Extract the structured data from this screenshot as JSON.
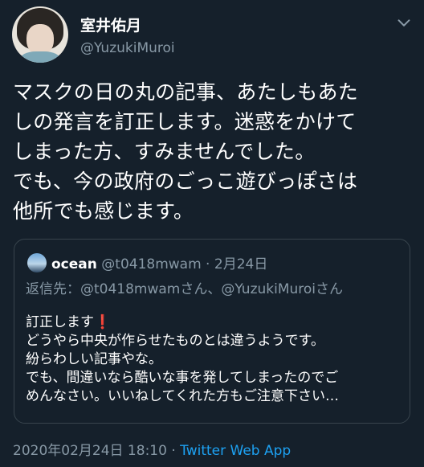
{
  "author": {
    "display_name": "室井佑月",
    "handle": "@YuzukiMuroi"
  },
  "icons": {
    "menu": "chevron-down-icon",
    "avatar": "profile-photo",
    "quoted_avatar": "profile-photo"
  },
  "tweet": {
    "lines": [
      "マスクの日の丸の記事、あたしもあた",
      "しの発言を訂正します。迷惑をかけて",
      "しまった方、すみませんでした。",
      "でも、今の政府のごっこ遊びっぽさは",
      "他所でも感じます。"
    ]
  },
  "quoted": {
    "name": "ocean",
    "handle": "@t0418mwam",
    "separator": " · ",
    "date": "2月24日",
    "reply_to": "返信先：@t0418mwamさん、@YuzukiMuroiさん",
    "first_line": "訂正します",
    "first_line_mark": "❗",
    "lines": [
      "どうやら中央が作らせたものとは違うようです。",
      "紛らわしい記事やな。",
      "でも、間違いなら酷いな事を発してしまったのでご",
      "めんなさい。いいねしてくれた方もご注意下さい…"
    ]
  },
  "meta": {
    "timestamp": "2020年02月24日 18:10",
    "separator": " · ",
    "source": "Twitter Web App"
  },
  "colors": {
    "background": "#15202b",
    "text": "#ffffff",
    "secondary": "#8899a6",
    "link": "#1da1f2",
    "border": "#38444d",
    "exclamation": "#e0245e"
  }
}
